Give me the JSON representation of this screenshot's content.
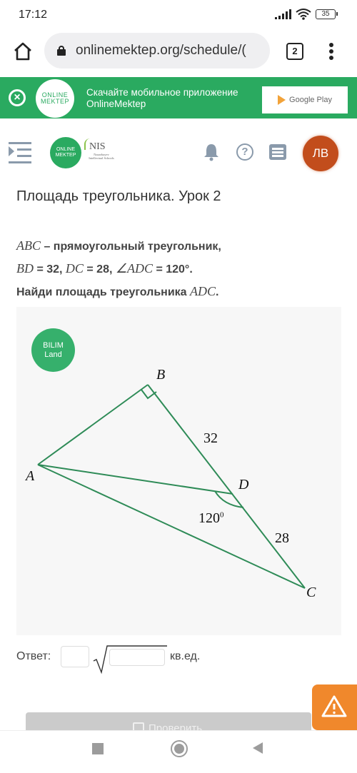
{
  "status_bar": {
    "time": "17:12",
    "battery": "35",
    "icons": [
      "signal-icon",
      "wifi-icon",
      "battery-icon"
    ]
  },
  "browser": {
    "url": "onlinemektep.org/schedule/(",
    "tab_count": "2",
    "icons": [
      "home-icon",
      "lock-icon",
      "more-vert-icon"
    ]
  },
  "app_banner": {
    "logo_line1": "ONLINE",
    "logo_line2": "MEKTEP",
    "text_line1": "Скачайте мобильное приложение",
    "text_line2": "OnlineMektep",
    "store_button": "Google Play",
    "close_glyph": "×",
    "accent_color": "#2aaa60"
  },
  "header": {
    "logo_line1": "ONLINE",
    "logo_line2": "MEKTEP",
    "nis_title": "NIS",
    "nis_subtitle": "Nazarbayev Intellectual Schools",
    "help_glyph": "?",
    "avatar_initials": "ЛВ",
    "avatar_color": "#c24d1c",
    "icons": [
      "menu-toggle-icon",
      "bell-icon",
      "help-icon",
      "list-icon"
    ]
  },
  "lesson": {
    "title": "Площадь треугольника. Урок 2",
    "task": {
      "line1_math": "ABC",
      "line1_text": " – прямоугольный треугольник,",
      "line2": [
        {
          "m": "BD"
        },
        {
          "t": " = 32, "
        },
        {
          "m": "DC"
        },
        {
          "t": " = 28, "
        },
        {
          "m": "∠ADC"
        },
        {
          "t": " = 120°."
        }
      ],
      "line3_text": "Найди площадь треугольника ",
      "line3_math": "ADC",
      "line3_end": "."
    }
  },
  "diagram": {
    "badge_line1": "BILIM",
    "badge_line2": "Land",
    "stroke_color": "#2e8b57",
    "points": {
      "A": "A",
      "B": "B",
      "C": "C",
      "D": "D"
    },
    "labels": {
      "bd": "32",
      "dc": "28",
      "angle": "120",
      "angle_sup": "0"
    },
    "right_angle_at": "B"
  },
  "answer": {
    "label": "Ответ:",
    "coefficient_value": "",
    "radicand_value": "",
    "unit": "кв.ед."
  },
  "check_button": {
    "label": "Проверить"
  },
  "report_button": {
    "icon": "warning-icon",
    "color": "#f0882c"
  },
  "nav": {
    "icons": [
      "recent-apps-icon",
      "home-circle-icon",
      "back-icon"
    ]
  }
}
